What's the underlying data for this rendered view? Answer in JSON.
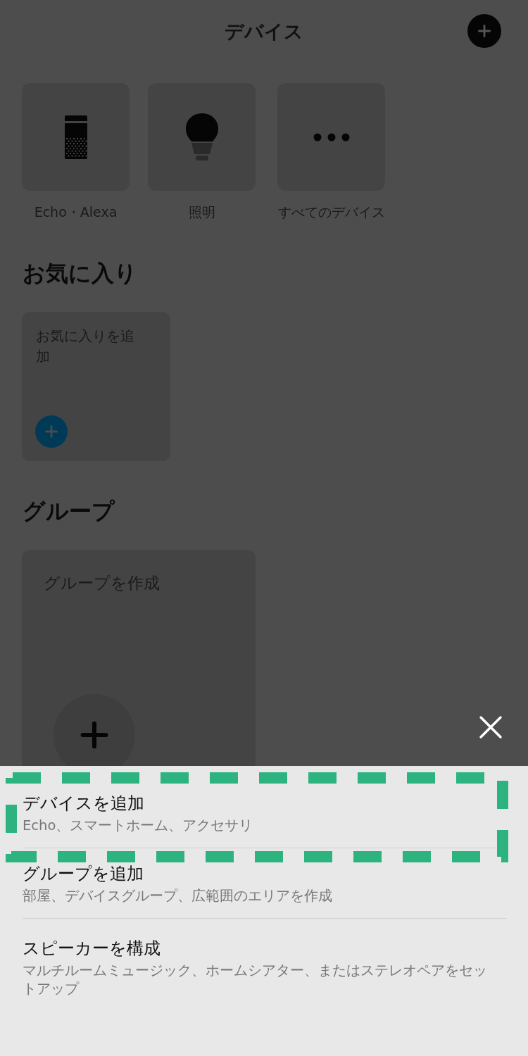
{
  "header": {
    "title": "デバイス"
  },
  "device_shortcuts": [
    {
      "kind": "echo",
      "label": "Echo・Alexa"
    },
    {
      "kind": "bulb",
      "label": "照明"
    },
    {
      "kind": "more",
      "label": "すべてのデバイス"
    }
  ],
  "favorites": {
    "heading": "お気に入り",
    "card_text": "お気に入りを追加"
  },
  "groups": {
    "heading": "グループ",
    "card_text": "グループを作成"
  },
  "add_menu": {
    "items": [
      {
        "title": "デバイスを追加",
        "subtitle": "Echo、スマートホーム、アクセサリ",
        "highlighted": true
      },
      {
        "title": "グループを追加",
        "subtitle": "部屋、デバイスグループ、広範囲のエリアを作成",
        "highlighted": false
      },
      {
        "title": "スピーカーを構成",
        "subtitle": "マルチルームミュージック、ホームシアター、またはステレオペアをセットアップ",
        "highlighted": false
      }
    ]
  }
}
